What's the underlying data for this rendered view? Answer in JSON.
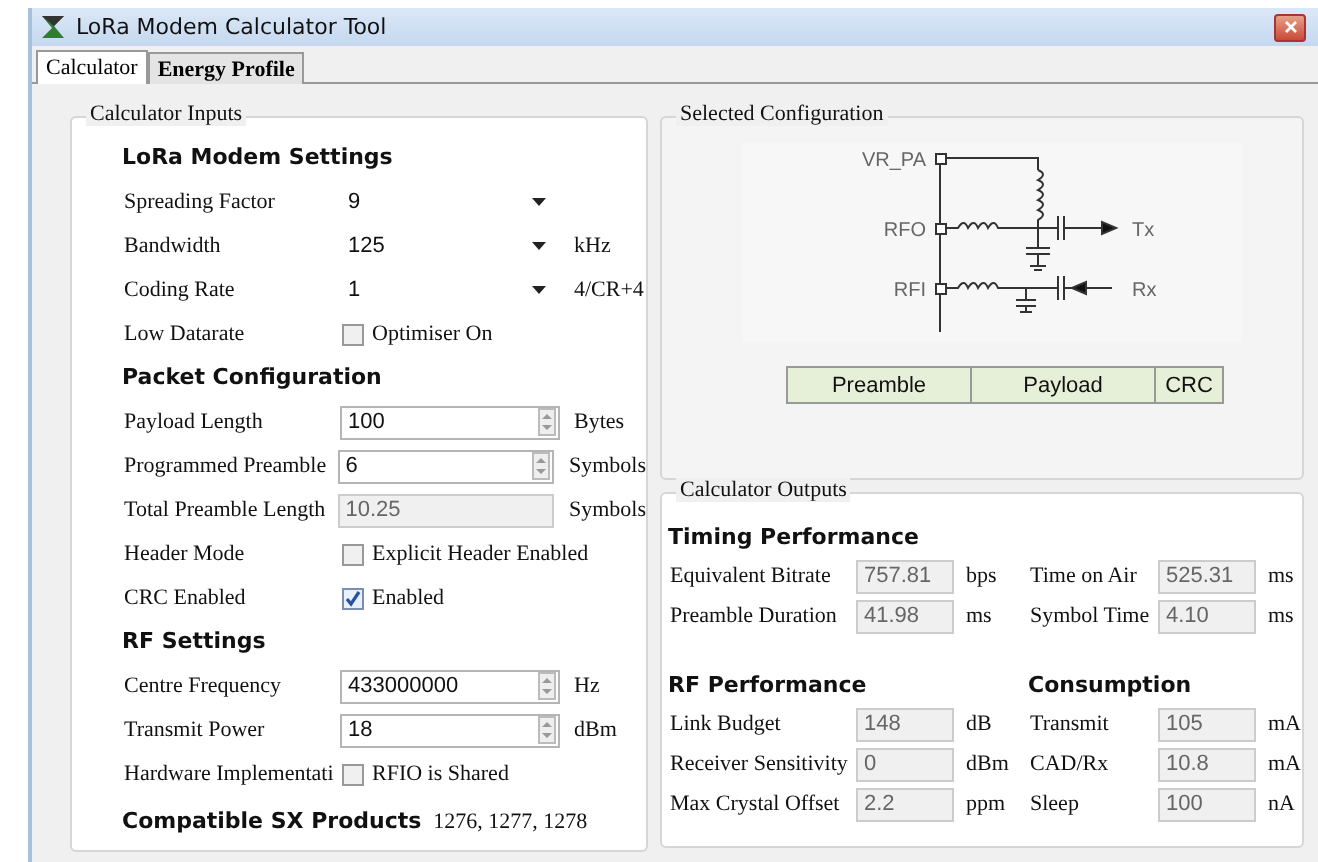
{
  "window": {
    "title": "LoRa Modem Calculator Tool"
  },
  "tabs": [
    {
      "label": "Calculator",
      "selected": true
    },
    {
      "label": "Energy Profile",
      "selected": false
    }
  ],
  "inputs": {
    "title": "Calculator Inputs",
    "sections": [
      {
        "heading": "LoRa Modem Settings",
        "rows": [
          {
            "kind": "combo",
            "label": "Spreading Factor",
            "value": "9"
          },
          {
            "kind": "combo",
            "label": "Bandwidth",
            "value": "125",
            "unit": "kHz"
          },
          {
            "kind": "combo",
            "label": "Coding Rate",
            "value": "1",
            "unit": "4/CR+4"
          },
          {
            "kind": "check",
            "label": "Low Datarate",
            "text": "Optimiser On",
            "checked": false
          }
        ]
      },
      {
        "heading": "Packet Configuration",
        "rows": [
          {
            "kind": "spin",
            "label": "Payload Length",
            "value": "100",
            "unit": "Bytes"
          },
          {
            "kind": "spin",
            "label": "Programmed Preamble",
            "value": "6",
            "unit": "Symbols"
          },
          {
            "kind": "readonly",
            "label": "Total Preamble Length",
            "value": "10.25",
            "unit": "Symbols"
          },
          {
            "kind": "check",
            "label": "Header Mode",
            "text": "Explicit Header Enabled",
            "checked": false
          },
          {
            "kind": "check",
            "label": "CRC Enabled",
            "text": "Enabled",
            "checked": true
          }
        ]
      },
      {
        "heading": "RF Settings",
        "rows": [
          {
            "kind": "spin",
            "label": "Centre Frequency",
            "value": "433000000",
            "unit": "Hz"
          },
          {
            "kind": "spin",
            "label": "Transmit Power",
            "value": "18",
            "unit": "dBm"
          },
          {
            "kind": "check",
            "label": "Hardware Implementati",
            "text": "RFIO is Shared",
            "checked": false
          }
        ]
      }
    ],
    "compatible": {
      "label": "Compatible SX Products",
      "value": "1276, 1277, 1278"
    }
  },
  "configuration": {
    "title": "Selected Configuration",
    "pins": [
      "VR_PA",
      "RFO",
      "RFI"
    ],
    "ports": [
      "Tx",
      "Rx"
    ],
    "packet": [
      "Preamble",
      "Payload",
      "CRC"
    ]
  },
  "outputs": {
    "title": "Calculator Outputs",
    "blocks": [
      {
        "heading": "Timing Performance",
        "fields": [
          {
            "label": "Equivalent Bitrate",
            "value": "757.81",
            "unit": "bps"
          },
          {
            "label": "Preamble Duration",
            "value": "41.98",
            "unit": "ms"
          }
        ]
      },
      {
        "fields": [
          {
            "label": "Time on Air",
            "value": "525.31",
            "unit": "ms"
          },
          {
            "label": "Symbol Time",
            "value": "4.10",
            "unit": "ms"
          }
        ]
      },
      {
        "heading": "RF Performance",
        "fields": [
          {
            "label": "Link Budget",
            "value": "148",
            "unit": "dB"
          },
          {
            "label": "Receiver Sensitivity",
            "value": "0",
            "unit": "dBm"
          },
          {
            "label": "Max Crystal Offset",
            "value": "2.2",
            "unit": "ppm"
          }
        ]
      },
      {
        "heading": "Consumption",
        "fields": [
          {
            "label": "Transmit",
            "value": "105",
            "unit": "mA"
          },
          {
            "label": "CAD/Rx",
            "value": "10.8",
            "unit": "mA"
          },
          {
            "label": "Sleep",
            "value": "100",
            "unit": "nA"
          }
        ]
      }
    ]
  }
}
